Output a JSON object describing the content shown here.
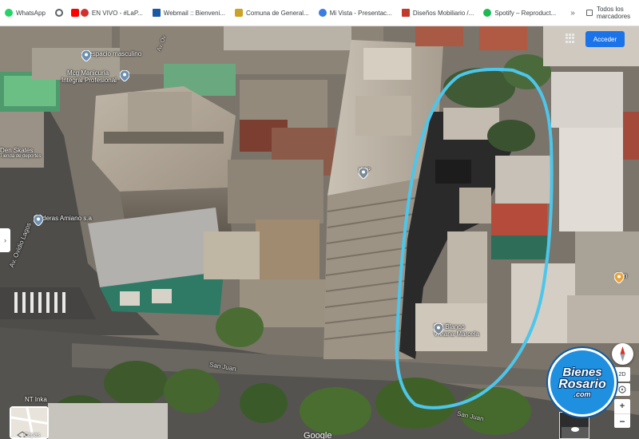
{
  "bookmarks": {
    "items": [
      {
        "label": "WhatsApp",
        "icon": "whatsapp-icon",
        "color": "#25d366"
      },
      {
        "label": "",
        "icon": "chrome-icon",
        "color": "#5f6368"
      },
      {
        "label": "EN VIVO - #LaP...",
        "icon": "youtube-icon",
        "color": "#ff0000"
      },
      {
        "label": "Webmail :: Bienveni...",
        "icon": "mail-icon",
        "color": "#1a5aa5"
      },
      {
        "label": "Comuna de General...",
        "icon": "shield-icon",
        "color": "#c9a227"
      },
      {
        "label": "Mi Vista - Presentac...",
        "icon": "vista-icon",
        "color": "#3b7de0"
      },
      {
        "label": "Diseños Mobiliario /...",
        "icon": "bookmark-icon",
        "color": "#c0392b"
      },
      {
        "label": "Spotify – Reproduct...",
        "icon": "spotify-icon",
        "color": "#1db954"
      }
    ],
    "more": "»",
    "folder_label": "Todos los marcadores"
  },
  "map": {
    "signin_label": "Acceder",
    "left_tab_arrow": "›",
    "google_label": "Google",
    "layers_label": "Capas",
    "view_2d_label": "2D",
    "zoom_in": "+",
    "zoom_out": "−",
    "highlight_color": "#4cc6ea",
    "places": [
      {
        "name": "L espacio masculino"
      },
      {
        "name": "Mcg Manicuria"
      },
      {
        "name": "Integral Profesional"
      },
      {
        "name": "Den Skates"
      },
      {
        "name": "Tienda de deportes"
      },
      {
        "name": "Maderas Amiano s.a"
      },
      {
        "name": "Del Blanco"
      },
      {
        "name": "Viviana Marcela"
      },
      {
        "name": "NT Inka"
      },
      {
        "name": "Pan"
      },
      {
        "name": "KGP"
      }
    ],
    "streets": [
      {
        "name": "Av. Ovidio Lagos"
      },
      {
        "name": "San Juan"
      },
      {
        "name": "San Juan"
      },
      {
        "name": "Av. Ov"
      }
    ]
  },
  "watermark": {
    "line1": "Bienes",
    "line2": "Rosario",
    "line3": ".com"
  }
}
